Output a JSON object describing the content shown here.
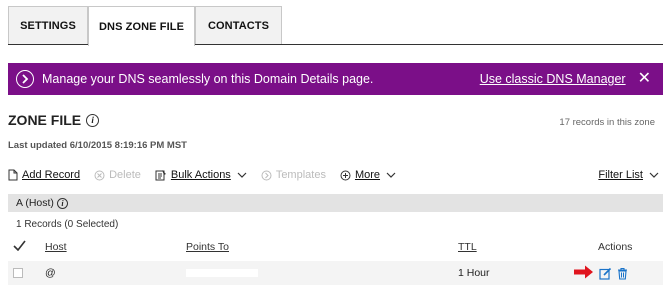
{
  "tabs": [
    {
      "label": "SETTINGS"
    },
    {
      "label": "DNS ZONE FILE"
    },
    {
      "label": "CONTACTS"
    }
  ],
  "banner": {
    "message": "Manage your DNS seamlessly on this Domain Details page.",
    "classic_link": "Use classic DNS Manager",
    "close": "✕",
    "color": "#7b0f88"
  },
  "zone": {
    "title": "ZONE FILE",
    "records_count": "17 records in this zone",
    "last_updated": "Last updated 6/10/2015 8:19:16 PM MST"
  },
  "toolbar": {
    "add_record": "Add Record",
    "delete": "Delete",
    "bulk_actions": "Bulk Actions",
    "templates": "Templates",
    "more": "More",
    "filter_list": "Filter List"
  },
  "section": {
    "title": "A (Host)",
    "records_selected": "1 Records (0 Selected)"
  },
  "table": {
    "headers": {
      "check": "✓",
      "host": "Host",
      "points_to": "Points To",
      "ttl": "TTL",
      "actions": "Actions"
    },
    "rows": [
      {
        "host": "@",
        "points_to": "",
        "ttl": "1 Hour"
      }
    ]
  },
  "icons": [
    "info-icon",
    "chevron-right-icon",
    "close-icon",
    "document-icon",
    "delete-icon",
    "bulk-actions-icon",
    "templates-icon",
    "more-icon",
    "chevron-down-icon",
    "edit-icon",
    "trash-icon",
    "red-arrow-icon"
  ]
}
